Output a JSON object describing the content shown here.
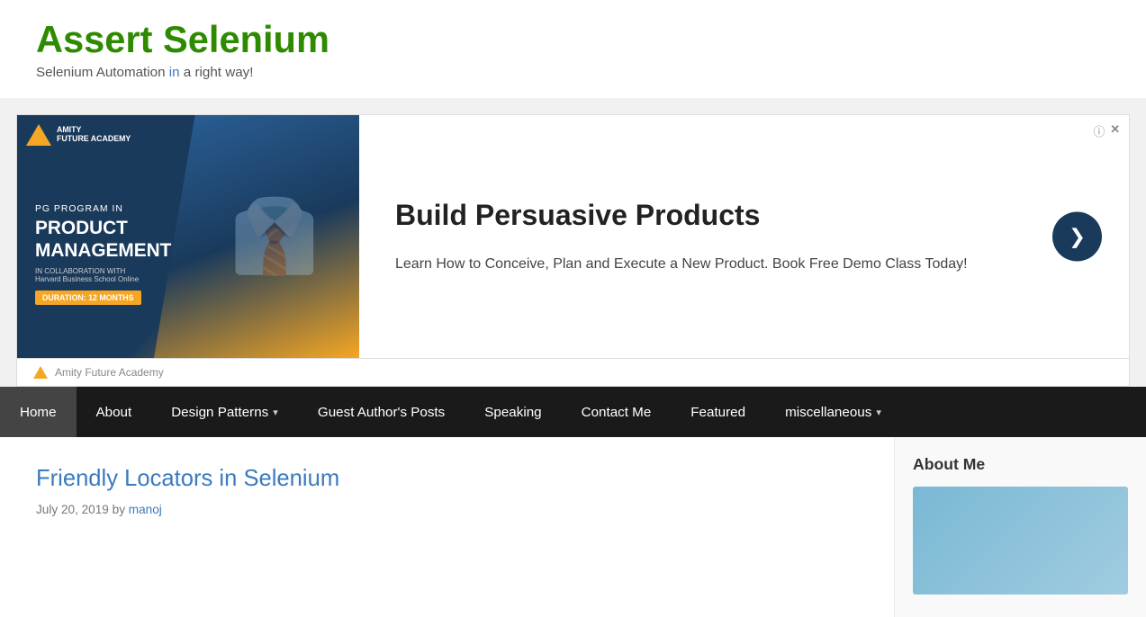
{
  "site": {
    "title": "Assert Selenium",
    "tagline_parts": [
      "Selenium Automation ",
      "in",
      " a right way!"
    ],
    "tagline_highlight": "in"
  },
  "ad": {
    "headline": "Build Persuasive Products",
    "description": "Learn How to Conceive, Plan and Execute a New Product. Book Free Demo Class Today!",
    "logo_text_line1": "AMITY",
    "logo_text_line2": "FUTURE ACADEMY",
    "program_label": "PG PROGRAM IN",
    "program_title_line1": "PRODUCT",
    "program_title_line2": "MANAGEMENT",
    "collab_text": "IN COLLABORATION WITH",
    "collab_school": "Harvard Business School Online",
    "duration_badge": "DURATION: 12 MONTHS",
    "footer_brand": "Amity Future Academy",
    "arrow_icon": "❯",
    "info_icon": "ⓘ",
    "close_icon": "✕"
  },
  "nav": {
    "items": [
      {
        "label": "Home",
        "active": true,
        "has_dropdown": false
      },
      {
        "label": "About",
        "active": false,
        "has_dropdown": false
      },
      {
        "label": "Design Patterns",
        "active": false,
        "has_dropdown": true
      },
      {
        "label": "Guest Author's Posts",
        "active": false,
        "has_dropdown": false
      },
      {
        "label": "Speaking",
        "active": false,
        "has_dropdown": false
      },
      {
        "label": "Contact Me",
        "active": false,
        "has_dropdown": false
      },
      {
        "label": "Featured",
        "active": false,
        "has_dropdown": false
      },
      {
        "label": "miscellaneous",
        "active": false,
        "has_dropdown": true
      }
    ]
  },
  "post": {
    "title": "Friendly Locators in Selenium",
    "date": "July 20, 2019",
    "author_prefix": "by",
    "author_name": "manoj",
    "url": "#"
  },
  "sidebar": {
    "about_title": "About Me"
  }
}
